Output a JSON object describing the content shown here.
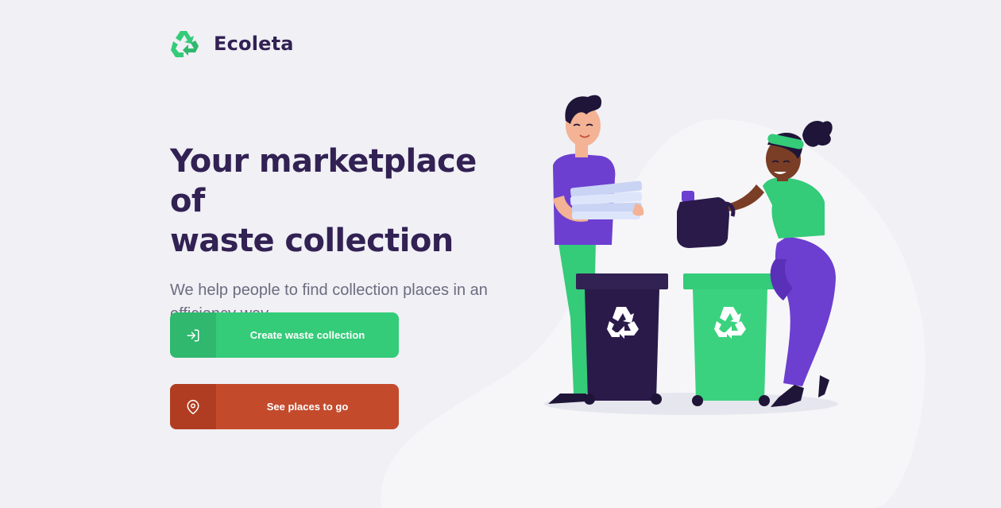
{
  "brand": {
    "name": "Ecoleta",
    "icon": "recycle-icon",
    "color": "#34cb79"
  },
  "hero": {
    "title_line1": "Your marketplace of",
    "title_line2": "waste collection",
    "subtitle": "We help people to find collection places in an efficiency way"
  },
  "actions": {
    "create_label": "Create waste collection",
    "create_icon": "sign-in-icon",
    "places_label": "See places to go",
    "places_icon": "map-pin-icon"
  },
  "colors": {
    "background": "#f0f0f5",
    "title": "#322153",
    "text": "#6c6c80",
    "primary": "#34cb79",
    "secondary": "#c44a2c"
  }
}
